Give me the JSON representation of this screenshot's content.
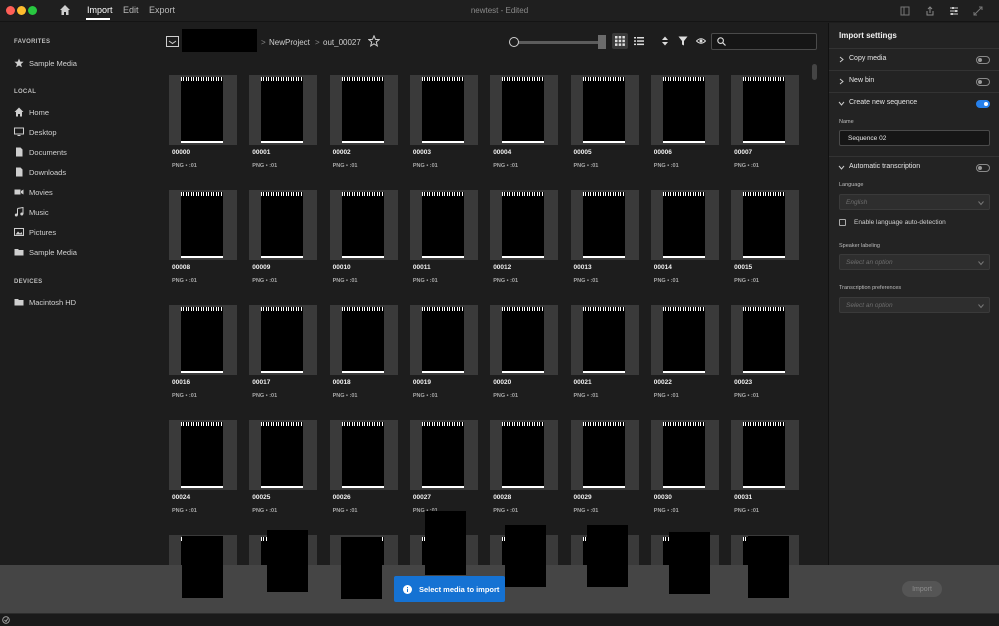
{
  "window": {
    "title": "newtest - Edited"
  },
  "menu": {
    "import": "Import",
    "edit": "Edit",
    "export": "Export"
  },
  "sidebar": {
    "favorites_heading": "FAVORITES",
    "favorites": [
      {
        "label": "Sample Media",
        "icon": "star-icon"
      }
    ],
    "local_heading": "LOCAL",
    "local": [
      {
        "label": "Home",
        "icon": "home-icon"
      },
      {
        "label": "Desktop",
        "icon": "desktop-icon"
      },
      {
        "label": "Documents",
        "icon": "document-icon"
      },
      {
        "label": "Downloads",
        "icon": "document-icon"
      },
      {
        "label": "Movies",
        "icon": "camera-icon"
      },
      {
        "label": "Music",
        "icon": "music-icon"
      },
      {
        "label": "Pictures",
        "icon": "pictures-icon"
      },
      {
        "label": "Sample Media",
        "icon": "folder-icon"
      }
    ],
    "devices_heading": "DEVICES",
    "devices": [
      {
        "label": "Macintosh HD",
        "icon": "drive-icon"
      }
    ]
  },
  "path": {
    "crumbs": [
      "NewProject",
      "out_00027"
    ],
    "separator": ">"
  },
  "search": {
    "placeholder": ""
  },
  "media": {
    "items": [
      {
        "name": "00000",
        "meta": "PNG • :01"
      },
      {
        "name": "00001",
        "meta": "PNG • :01"
      },
      {
        "name": "00002",
        "meta": "PNG • :01"
      },
      {
        "name": "00003",
        "meta": "PNG • :01"
      },
      {
        "name": "00004",
        "meta": "PNG • :01"
      },
      {
        "name": "00005",
        "meta": "PNG • :01"
      },
      {
        "name": "00006",
        "meta": "PNG • :01"
      },
      {
        "name": "00007",
        "meta": "PNG • :01"
      },
      {
        "name": "00008",
        "meta": "PNG • :01"
      },
      {
        "name": "00009",
        "meta": "PNG • :01"
      },
      {
        "name": "00010",
        "meta": "PNG • :01"
      },
      {
        "name": "00011",
        "meta": "PNG • :01"
      },
      {
        "name": "00012",
        "meta": "PNG • :01"
      },
      {
        "name": "00013",
        "meta": "PNG • :01"
      },
      {
        "name": "00014",
        "meta": "PNG • :01"
      },
      {
        "name": "00015",
        "meta": "PNG • :01"
      },
      {
        "name": "00016",
        "meta": "PNG • :01"
      },
      {
        "name": "00017",
        "meta": "PNG • :01"
      },
      {
        "name": "00018",
        "meta": "PNG • :01"
      },
      {
        "name": "00019",
        "meta": "PNG • :01"
      },
      {
        "name": "00020",
        "meta": "PNG • :01"
      },
      {
        "name": "00021",
        "meta": "PNG • :01"
      },
      {
        "name": "00022",
        "meta": "PNG • :01"
      },
      {
        "name": "00023",
        "meta": "PNG • :01"
      },
      {
        "name": "00024",
        "meta": "PNG • :01"
      },
      {
        "name": "00025",
        "meta": "PNG • :01"
      },
      {
        "name": "00026",
        "meta": "PNG • :01"
      },
      {
        "name": "00027",
        "meta": "PNG • :01"
      },
      {
        "name": "00028",
        "meta": "PNG • :01"
      },
      {
        "name": "00029",
        "meta": "PNG • :01"
      },
      {
        "name": "00030",
        "meta": "PNG • :01"
      },
      {
        "name": "00031",
        "meta": "PNG • :01"
      },
      {
        "name": "",
        "meta": ""
      },
      {
        "name": "",
        "meta": ""
      },
      {
        "name": "",
        "meta": ""
      },
      {
        "name": "",
        "meta": ""
      },
      {
        "name": "",
        "meta": ""
      },
      {
        "name": "",
        "meta": ""
      },
      {
        "name": "",
        "meta": ""
      },
      {
        "name": "",
        "meta": ""
      }
    ]
  },
  "toast": {
    "message": "Select media to import"
  },
  "import_button": {
    "label": "Import"
  },
  "panel": {
    "title": "Import settings",
    "copy_media": {
      "label": "Copy media",
      "on": false
    },
    "new_bin": {
      "label": "New bin",
      "on": false
    },
    "create_sequence": {
      "label": "Create new sequence",
      "on": true,
      "name_label": "Name",
      "name_value": "Sequence 02"
    },
    "transcription": {
      "label": "Automatic transcription",
      "on": false,
      "language_label": "Language",
      "language_value": "English",
      "auto_detect_label": "Enable language auto-detection",
      "speaker_label": "Speaker labeling",
      "speaker_value": "Select an option",
      "prefs_label": "Transcription preferences",
      "prefs_value": "Select an option"
    }
  }
}
